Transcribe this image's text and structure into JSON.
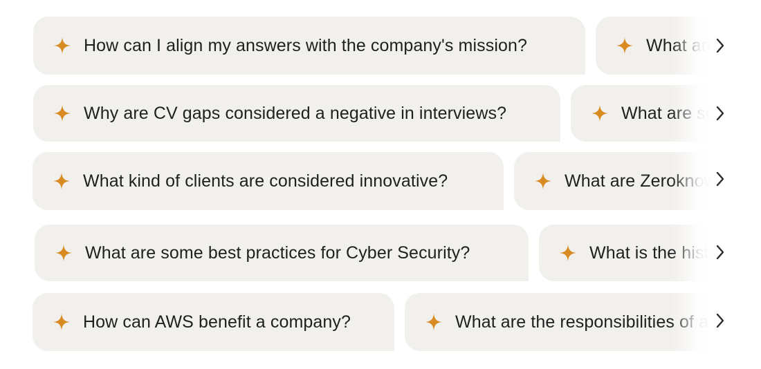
{
  "accent_color": "#d98a21",
  "chip_background": "#f2f0ec",
  "icons": {
    "chip": "sparkle-icon",
    "scroll": "chevron-right-icon"
  },
  "rows": [
    {
      "chips": [
        {
          "label": "How can I align my answers with the company's mission?"
        },
        {
          "label": "What are the company's core values?"
        }
      ]
    },
    {
      "chips": [
        {
          "label": "Why are CV gaps considered a negative in interviews?"
        },
        {
          "label": "What are some common interview mistakes?"
        }
      ]
    },
    {
      "chips": [
        {
          "label": "What kind of clients are considered innovative?"
        },
        {
          "label": "What are Zeroknowledge proofs?"
        }
      ]
    },
    {
      "chips": [
        {
          "label": "What are some best practices for Cyber Security?"
        },
        {
          "label": "What is the history of the company?"
        }
      ]
    },
    {
      "chips": [
        {
          "label": "How can AWS benefit a company?"
        },
        {
          "label": "What are the responsibilities of a product manager?"
        }
      ]
    }
  ]
}
